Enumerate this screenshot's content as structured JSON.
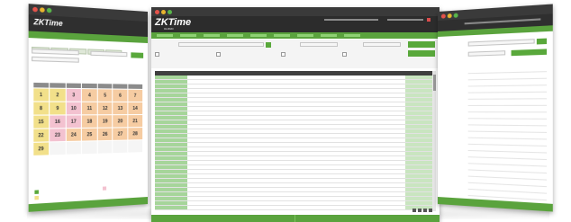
{
  "left_window": {
    "logo": "ZKTime",
    "calendar": {
      "day_numbers": [
        [
          "1",
          "2",
          "3",
          "4",
          "5",
          "6",
          "7"
        ],
        [
          "8",
          "9",
          "10",
          "11",
          "12",
          "13",
          "14"
        ],
        [
          "15",
          "16",
          "17",
          "18",
          "19",
          "20",
          "21"
        ],
        [
          "22",
          "23",
          "24",
          "25",
          "26",
          "27",
          "28"
        ],
        [
          "29",
          "",
          "",
          "",
          "",
          "",
          ""
        ]
      ]
    }
  },
  "center_window": {
    "logo": "ZKTime",
    "logo_sub": "CLOUD"
  },
  "colors": {
    "accent_green": "#5aa33d",
    "header_dark": "#2c2c2c",
    "cell_yellow": "#f2e08a",
    "cell_pink": "#f3c2d0",
    "cell_peach": "#f6cca2"
  }
}
